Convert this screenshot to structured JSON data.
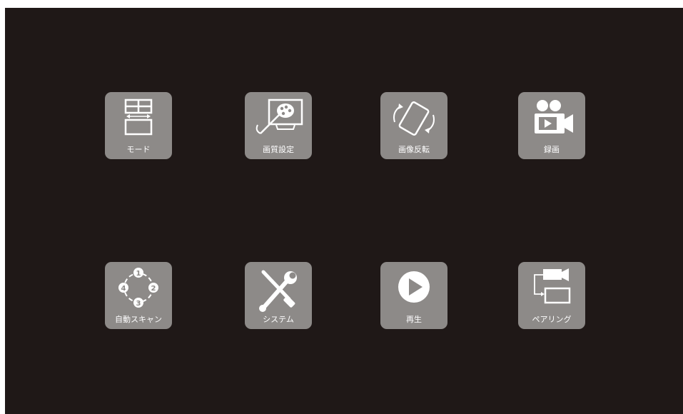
{
  "colors": {
    "screen": "#1f1817",
    "tile": "#8d8a88",
    "icon": "#ffffff"
  },
  "menu": {
    "items": [
      {
        "label": "モード",
        "icon": "mode-split-icon"
      },
      {
        "label": "画質設定",
        "icon": "image-quality-palette-icon"
      },
      {
        "label": "画像反転",
        "icon": "image-flip-rotate-icon"
      },
      {
        "label": "録画",
        "icon": "video-camera-record-icon"
      },
      {
        "label": "自動スキャン",
        "icon": "auto-scan-cycle-icon"
      },
      {
        "label": "システム",
        "icon": "tools-wrench-screwdriver-icon"
      },
      {
        "label": "再生",
        "icon": "play-icon"
      },
      {
        "label": "ペアリング",
        "icon": "pairing-camera-monitor-icon"
      }
    ]
  }
}
